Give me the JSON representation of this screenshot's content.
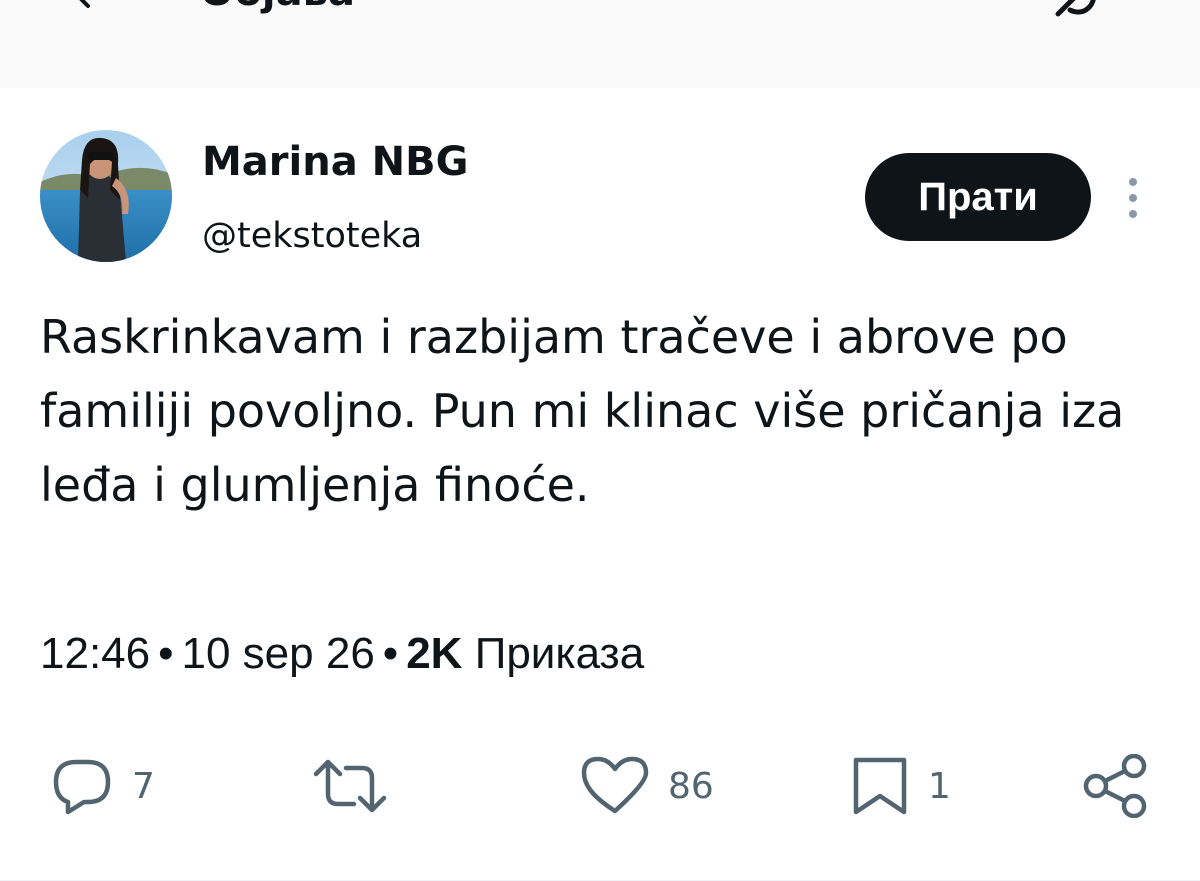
{
  "header": {
    "title": "Објава",
    "back_icon": "arrow-left-icon",
    "grok_icon": "grok-icon"
  },
  "post": {
    "author": {
      "display_name": "Marina NBG",
      "handle": "@tekstoteka",
      "avatar": "avatar-photo"
    },
    "follow_label": "Прати",
    "more_icon": "more-vertical-icon",
    "text": "Raskrinkavam i razbijam tračeve i abrove po familiji povoljno. Pun mi klinac više pričanja iza leđa i glumljenja finoće.",
    "time": "12:46",
    "date": "10 sep 26",
    "separator": "•",
    "views_count": "2K",
    "views_label": "Приказа",
    "actions": {
      "reply_count": "7",
      "repost_count": "",
      "like_count": "86",
      "bookmark_count": "1"
    }
  },
  "colors": {
    "text": "#0f1419",
    "muted": "#536471",
    "button_bg": "#0f1419",
    "button_text": "#ffffff",
    "header_bg": "#fafafa"
  }
}
